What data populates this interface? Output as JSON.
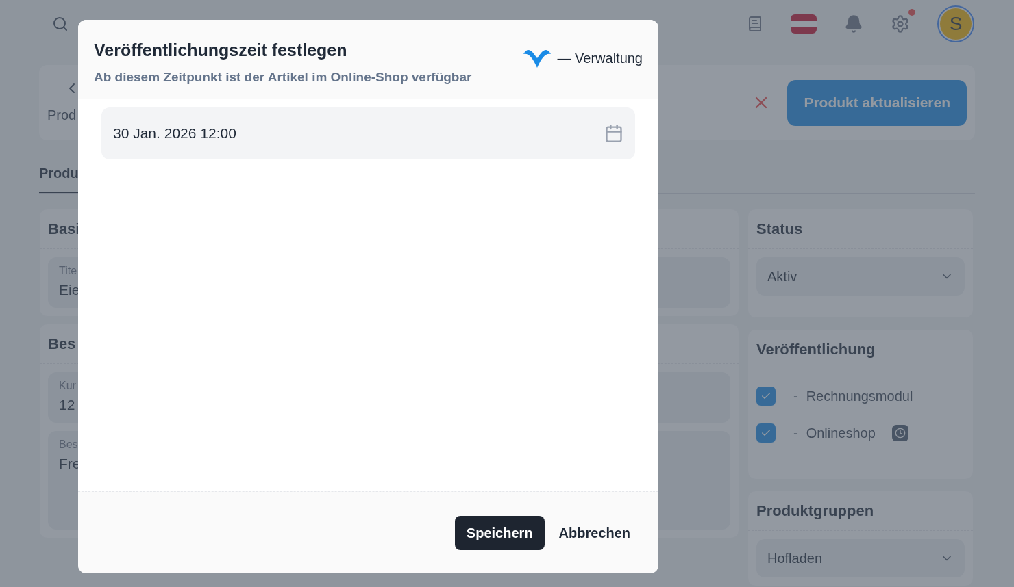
{
  "topbar": {
    "avatar": "S"
  },
  "header": {
    "title": "Prod",
    "update_button": "Produkt aktualisieren"
  },
  "tabs": [
    {
      "label": "Produ",
      "selected": true
    }
  ],
  "sections": [
    {
      "title": "Basi",
      "fields": [
        {
          "label": "Tite",
          "value": "Eie",
          "kind": "short"
        }
      ]
    },
    {
      "title": "Bes",
      "fields": [
        {
          "label": "Kur",
          "value": "12",
          "kind": "short"
        },
        {
          "label": "Bes",
          "value": "Fre",
          "kind": "long"
        }
      ]
    }
  ],
  "status": {
    "title": "Status",
    "value": "Aktiv"
  },
  "publication": {
    "title": "Veröffentlichung",
    "channels": [
      {
        "prefix": "-",
        "label": "Rechnungsmodul",
        "checked": true,
        "scheduled": false
      },
      {
        "prefix": "-",
        "label": "Onlineshop",
        "checked": true,
        "scheduled": true
      }
    ]
  },
  "product_groups": {
    "title": "Produktgruppen",
    "value": "Hofladen"
  },
  "dialog": {
    "title": "Veröffentlichungszeit festlegen",
    "subtitle": "Ab diesem Zeitpunkt ist der Artikel im Online-Shop verfügbar",
    "brand": "— Verwaltung",
    "datetime": "30 Jan. 2026 12:00",
    "buttons": [
      {
        "label": "Speichern",
        "kind": "primary"
      },
      {
        "label": "Abbrechen",
        "kind": "secondary"
      }
    ]
  }
}
